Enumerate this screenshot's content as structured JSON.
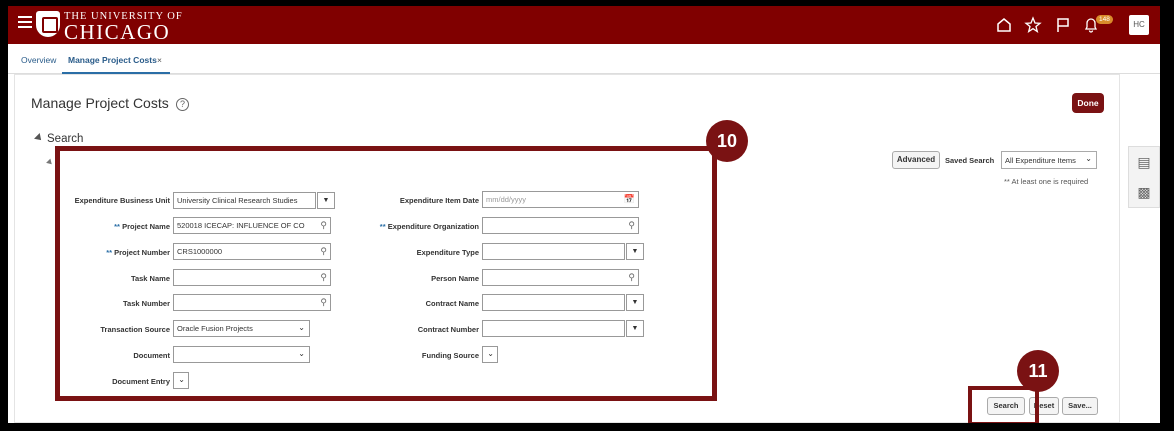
{
  "header": {
    "logo_line1": "THE UNIVERSITY OF",
    "logo_line2": "CHICAGO",
    "notification_count": "148",
    "avatar_initials": "HC"
  },
  "tabs": [
    {
      "label": "Overview"
    },
    {
      "label": "Manage Project Costs"
    }
  ],
  "tab_close": "×",
  "page": {
    "title": "Manage Project Costs",
    "help": "?",
    "done_label": "Done",
    "search_header": "Search"
  },
  "search_controls": {
    "advanced_label": "Advanced",
    "saved_search_label": "Saved Search",
    "saved_search_value": "All Expenditure Items",
    "required_note": "** At least one is required"
  },
  "left_fields": [
    {
      "label": "Expenditure Business Unit",
      "value": "University Clinical Research Studies"
    },
    {
      "label": "Project Name",
      "value": "520018 ICECAP: INFLUENCE OF CO",
      "required": "**"
    },
    {
      "label": "Project Number",
      "value": "CRS1000000",
      "required": "**"
    },
    {
      "label": "Task Name",
      "value": ""
    },
    {
      "label": "Task Number",
      "value": ""
    },
    {
      "label": "Transaction Source",
      "value": "Oracle Fusion Projects"
    },
    {
      "label": "Document",
      "value": ""
    },
    {
      "label": "Document Entry",
      "value": ""
    }
  ],
  "right_fields": [
    {
      "label": "Expenditure Item Date",
      "placeholder": "mm/dd/yyyy"
    },
    {
      "label": "Expenditure Organization",
      "value": "",
      "required": "**"
    },
    {
      "label": "Expenditure Type",
      "value": ""
    },
    {
      "label": "Person Name",
      "value": ""
    },
    {
      "label": "Contract Name",
      "value": ""
    },
    {
      "label": "Contract Number",
      "value": ""
    },
    {
      "label": "Funding Source",
      "value": ""
    }
  ],
  "actions": {
    "search": "Search",
    "reset": "Reset",
    "save": "Save..."
  },
  "annotations": {
    "step10": "10",
    "step11": "11"
  },
  "colors": {
    "brand": "#800000",
    "annotation": "#7a1213"
  }
}
